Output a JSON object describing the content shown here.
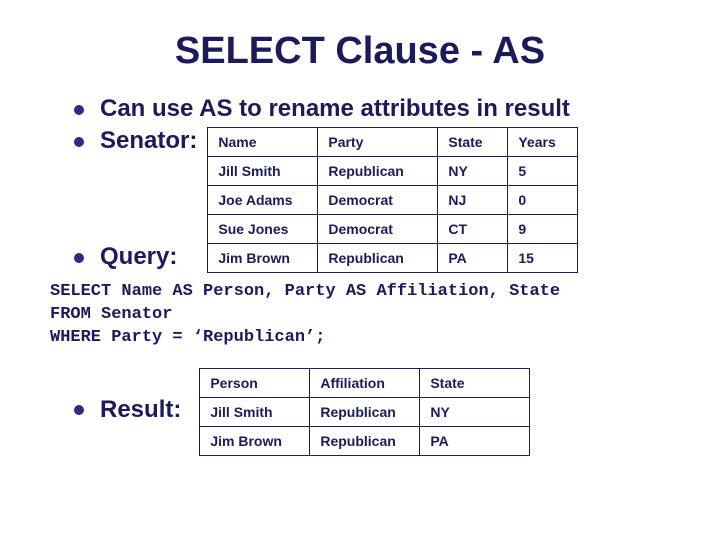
{
  "title": "SELECT Clause - AS",
  "bullets": {
    "line1": "Can use AS to rename attributes in result",
    "senator_label": "Senator:",
    "query_label": "Query:",
    "result_label": "Result:"
  },
  "senator_table": {
    "headers": [
      "Name",
      "Party",
      "State",
      "Years"
    ],
    "rows": [
      [
        "Jill Smith",
        "Republican",
        "NY",
        "5"
      ],
      [
        "Joe Adams",
        "Democrat",
        "NJ",
        "0"
      ],
      [
        "Sue Jones",
        "Democrat",
        "CT",
        "9"
      ],
      [
        "Jim Brown",
        "Republican",
        "PA",
        "15"
      ]
    ]
  },
  "query": {
    "l1": "SELECT Name AS Person, Party AS Affiliation, State",
    "l2": "FROM Senator",
    "l3": "WHERE Party = ‘Republican’;"
  },
  "result_table": {
    "headers": [
      "Person",
      "Affiliation",
      "State"
    ],
    "rows": [
      [
        "Jill Smith",
        "Republican",
        "NY"
      ],
      [
        "Jim Brown",
        "Republican",
        "PA"
      ]
    ]
  }
}
